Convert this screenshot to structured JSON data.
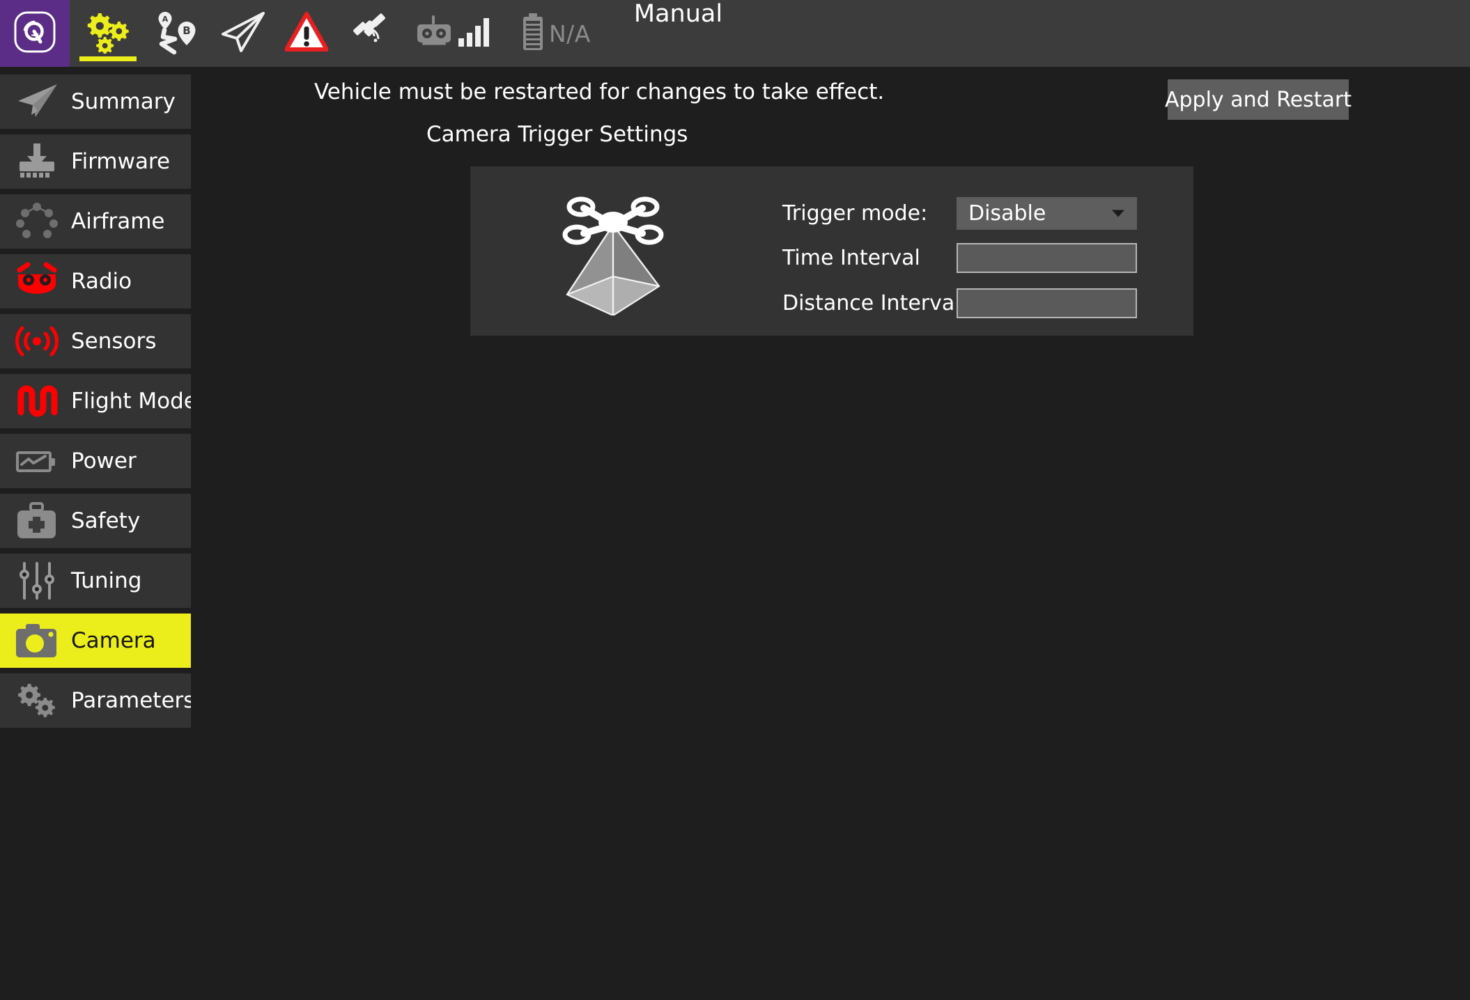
{
  "colors": {
    "accent_yellow": "#ecee1b",
    "logo_purple": "#5c2d86",
    "warning_red": "#e8201f",
    "sidebar_item_bg": "#333333",
    "app_bg": "#1e1e1e",
    "toolbar_bg": "#3c3c3c",
    "control_gray": "#5e5e5e"
  },
  "toolbar": {
    "logo_icon": "qgc-logo-icon",
    "buttons": [
      {
        "name": "setup",
        "icon": "gears-icon",
        "active": true
      },
      {
        "name": "plan",
        "icon": "waypoints-ab-icon",
        "active": false
      },
      {
        "name": "fly",
        "icon": "paper-plane-icon",
        "active": false
      },
      {
        "name": "warnings",
        "icon": "warning-triangle-icon",
        "active": false
      }
    ],
    "status": {
      "gps_icon": "satellite-icon",
      "rc_icon": "rc-transmitter-icon",
      "signal_icon": "signal-bars-icon",
      "battery_icon": "battery-icon",
      "battery_value": "N/A",
      "flight_mode": "Manual"
    }
  },
  "sidebar": {
    "items": [
      {
        "label": "Summary",
        "icon": "paper-plane-icon",
        "active": false
      },
      {
        "label": "Firmware",
        "icon": "firmware-chip-icon",
        "active": false
      },
      {
        "label": "Airframe",
        "icon": "airframe-icon",
        "active": false
      },
      {
        "label": "Radio",
        "icon": "radio-icon",
        "active": false
      },
      {
        "label": "Sensors",
        "icon": "sensors-icon",
        "active": false
      },
      {
        "label": "Flight Modes",
        "icon": "flight-modes-icon",
        "active": false
      },
      {
        "label": "Power",
        "icon": "power-battery-icon",
        "active": false
      },
      {
        "label": "Safety",
        "icon": "safety-kit-icon",
        "active": false
      },
      {
        "label": "Tuning",
        "icon": "tuning-sliders-icon",
        "active": false
      },
      {
        "label": "Camera",
        "icon": "camera-icon",
        "active": true
      },
      {
        "label": "Parameters",
        "icon": "parameters-gears-icon",
        "active": false
      }
    ]
  },
  "main": {
    "restart_message": "Vehicle must be restarted for changes to take effect.",
    "apply_button_label": "Apply and Restart",
    "section_title": "Camera Trigger Settings",
    "panel": {
      "illustration_icon": "drone-camera-frustum-icon",
      "trigger_mode": {
        "label": "Trigger mode:",
        "value": "Disable",
        "dropdown_icon": "chevron-down-icon"
      },
      "time_interval": {
        "label": "Time Interval",
        "value": "",
        "placeholder": ""
      },
      "distance_interval": {
        "label": "Distance Interval",
        "value": "",
        "placeholder": ""
      }
    }
  }
}
